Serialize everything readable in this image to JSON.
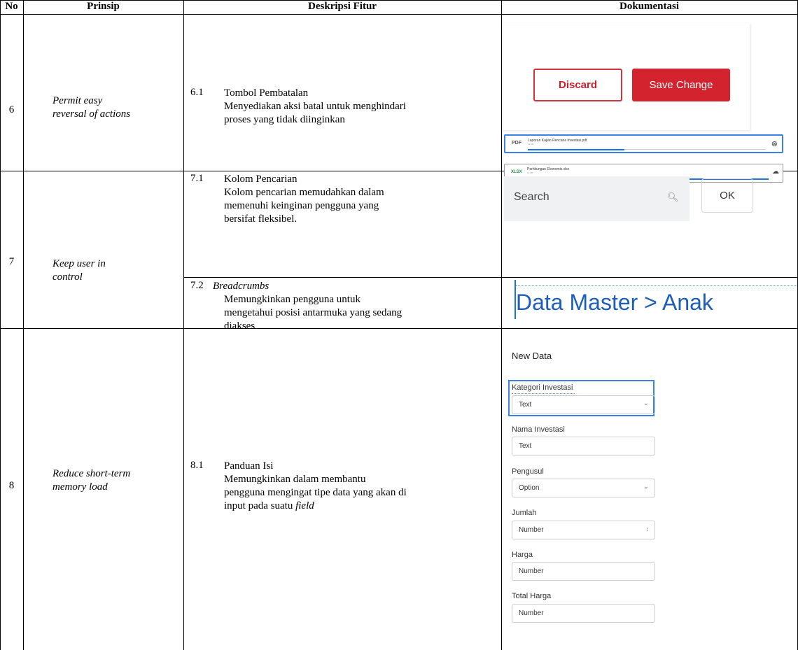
{
  "headers": [
    "No",
    "Prinsip",
    "Deskripsi Fitur",
    "Dokumentasi"
  ],
  "rows": {
    "r6": {
      "no": "6",
      "prinsip_1": "Permit easy",
      "prinsip_2": "reversal of actions",
      "num": "6.1",
      "title": "Tombol Pembatalan",
      "desc_1": "Menyediakan aksi batal untuk menghindari",
      "desc_2": "proses yang tidak diinginkan"
    },
    "r7": {
      "no": "7",
      "prinsip_1": "Keep user in",
      "prinsip_2": "control",
      "a_num": "7.1",
      "a_title": "Kolom Pencarian",
      "a_desc_1": "Kolom pencarian memudahkan dalam",
      "a_desc_2": "memenuhi keinginan pengguna yang",
      "a_desc_3": "bersifat fleksibel.",
      "b_num": "7.2",
      "b_title": "Breadcrumbs",
      "b_desc_1": "Memungkinkan pengguna untuk",
      "b_desc_2": "mengetahui posisi antarmuka yang sedang",
      "b_desc_3": "diakses"
    },
    "r8": {
      "no": "8",
      "prinsip_1": "Reduce short-term",
      "prinsip_2": "memory load",
      "num": "8.1",
      "title": "Panduan Isi",
      "desc_1": "Memungkinkan dalam membantu",
      "desc_2": "pengguna mengingat tipe data yang akan di",
      "desc_3": "input pada suatu ",
      "desc_3_italic": "field"
    }
  },
  "doc6": {
    "discard_label": "Discard",
    "save_label": "Save Change",
    "file1_name": "Laporan Kajian Rencana Investasi.pdf",
    "file1_size": "12 KB",
    "file1_type": "PDF",
    "file1_progress": 0.4,
    "file2_name": "Perhitungan Ekonomis.xlsx",
    "file2_size": "12 KB",
    "file2_type": "XLSX",
    "file2_progress": 1.0,
    "accent_color": "#d3232f",
    "progress_color": "#1a73e8"
  },
  "doc7": {
    "search_placeholder": "Search",
    "ok_label": "OK",
    "breadcrumb": "Data Master > Anak"
  },
  "doc8": {
    "form_title": "New Data",
    "fields": [
      {
        "label": "Kategori Investasi",
        "value": "Text",
        "kind": "select"
      },
      {
        "label": "Nama Investasi",
        "value": "Text",
        "kind": "text"
      },
      {
        "label": "Pengusul",
        "value": "Option",
        "kind": "select"
      },
      {
        "label": "Jumlah",
        "value": "Number",
        "kind": "number"
      },
      {
        "label": "Harga",
        "value": "Number",
        "kind": "text"
      },
      {
        "label": "Total Harga",
        "value": "Number",
        "kind": "text"
      }
    ]
  }
}
